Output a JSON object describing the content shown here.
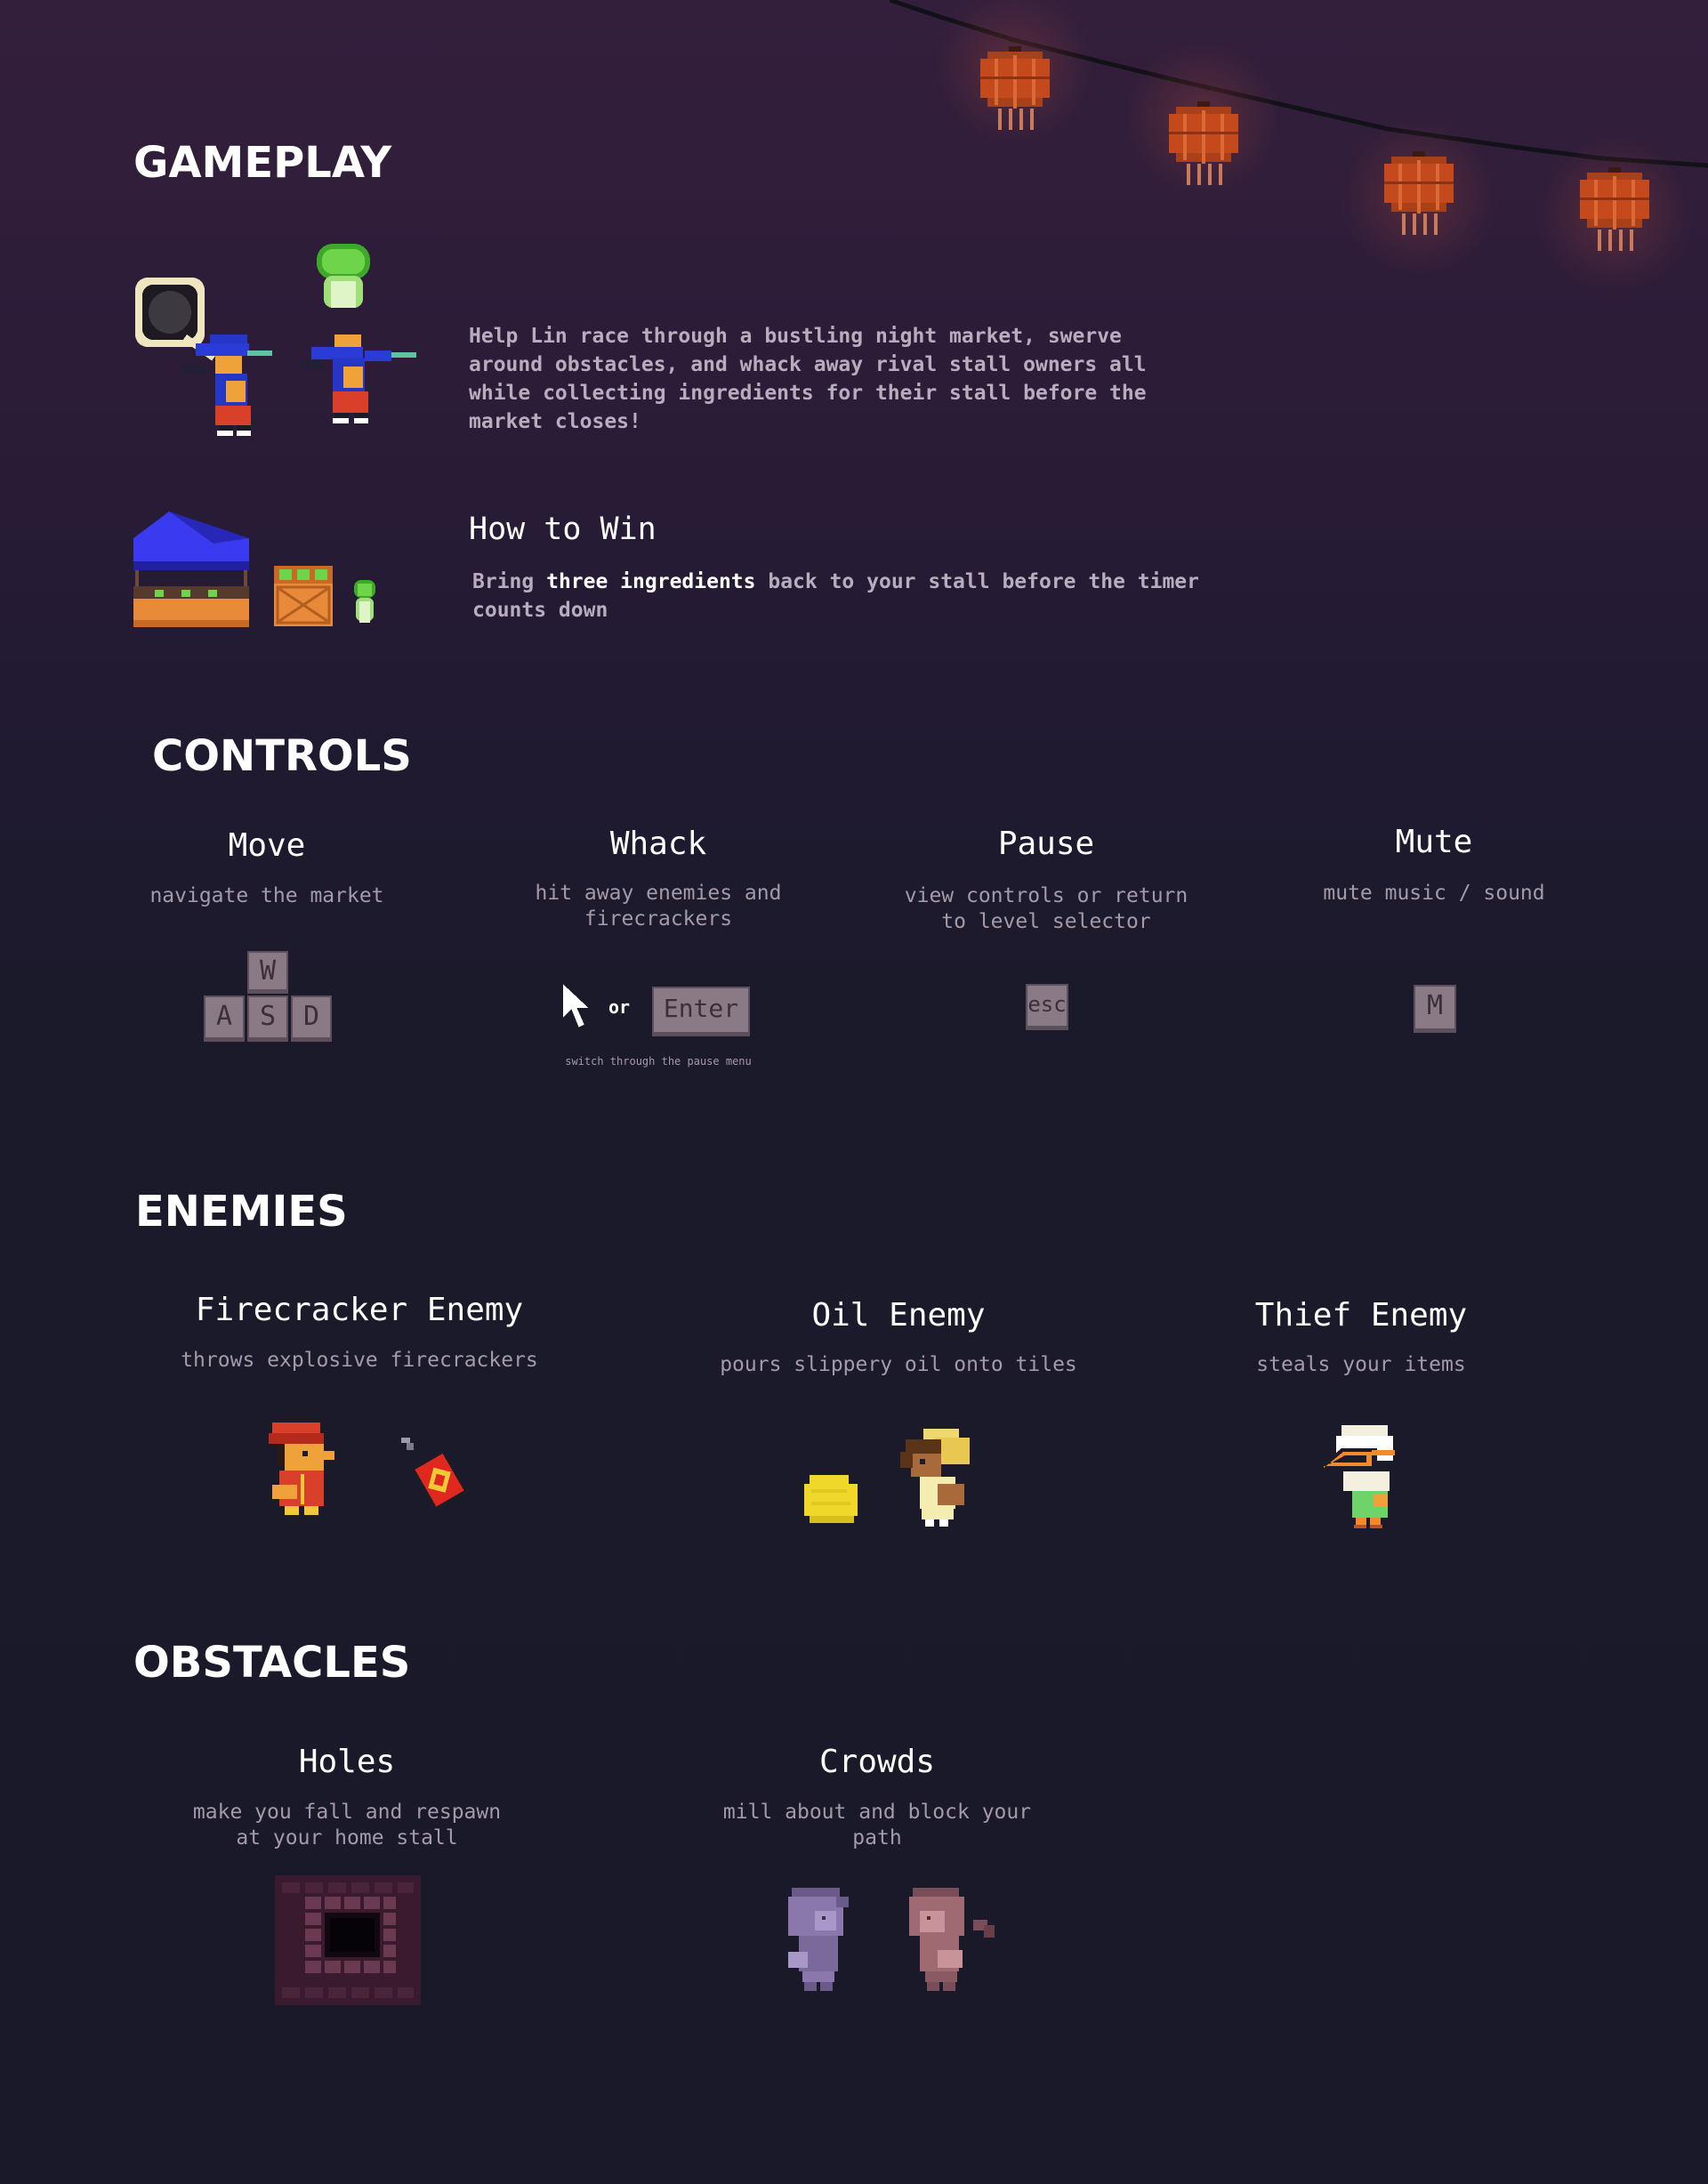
{
  "colors": {
    "background_top": "#331f3c",
    "background_bottom": "#19192a",
    "heading": "#ffffff",
    "body_text": "#b9adbd",
    "muted_text": "#a59aa8",
    "key_fill": "#8a7a86",
    "lantern": "#c44a1e",
    "stall_roof": "#2f2fd6"
  },
  "gameplay": {
    "title": "GAMEPLAY",
    "intro_paragraph": "Help Lin race through a bustling night market, swerve around obstacles, and whack away rival stall owners all while collecting ingredients for their stall before the market closes!",
    "how_to_win": {
      "title": "How to Win",
      "text_before": "Bring ",
      "text_bold": "three ingredients",
      "text_after": " back to your stall before the timer counts down"
    }
  },
  "controls": {
    "title": "CONTROLS",
    "items": [
      {
        "name": "Move",
        "description": "navigate the market",
        "keys": [
          "W",
          "A",
          "S",
          "D"
        ]
      },
      {
        "name": "Whack",
        "description": "hit away enemies and firecrackers",
        "or_label": "or",
        "key": "Enter",
        "note": "switch through the pause menu"
      },
      {
        "name": "Pause",
        "description": "view controls or return to level selector",
        "key": "esc"
      },
      {
        "name": "Mute",
        "description": "mute music / sound",
        "key": "M"
      }
    ]
  },
  "enemies": {
    "title": "ENEMIES",
    "items": [
      {
        "name": "Firecracker Enemy",
        "description": "throws explosive firecrackers"
      },
      {
        "name": "Oil Enemy",
        "description": "pours slippery oil onto tiles"
      },
      {
        "name": "Thief Enemy",
        "description": "steals your items"
      }
    ]
  },
  "obstacles": {
    "title": "OBSTACLES",
    "items": [
      {
        "name": "Holes",
        "description": "make you fall and respawn at your home stall"
      },
      {
        "name": "Crowds",
        "description": "mill about and block your path"
      }
    ]
  },
  "icons": {
    "lanterns": "lantern-icon",
    "player_frying_pan": "player-frying-pan-icon",
    "player_bok_choy": "player-bok-choy-icon",
    "stall": "market-stall-icon",
    "crate": "ingredient-crate-icon",
    "bok_choy": "bok-choy-icon",
    "mouse_cursor": "mouse-cursor-icon",
    "firecracker_enemy": "firecracker-enemy-icon",
    "firecracker": "firecracker-icon",
    "oil_puddle": "oil-puddle-icon",
    "oil_enemy": "oil-enemy-icon",
    "thief_enemy": "thief-enemy-icon",
    "hole": "hole-icon",
    "crowd_person_purple": "crowd-person-purple-icon",
    "crowd_person_pink": "crowd-person-pink-icon"
  }
}
